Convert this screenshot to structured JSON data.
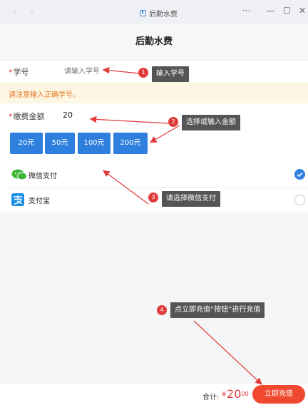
{
  "window": {
    "back_glyph": "‹",
    "forward_glyph": "›",
    "title": "后勤水费",
    "more_glyph": "···",
    "min_glyph": "—",
    "max_glyph": "☐",
    "close_glyph": "✕"
  },
  "page": {
    "title": "后勤水费"
  },
  "student_id": {
    "required_mark": "*",
    "label": "学号",
    "placeholder": "请输入学号",
    "value": ""
  },
  "warning": "请注意输入正确学号。",
  "amount": {
    "required_mark": "*",
    "label": "缴费金额",
    "value": "20"
  },
  "amount_options": [
    "20元",
    "50元",
    "100元",
    "200元"
  ],
  "payment_methods": [
    {
      "label": "微信支付",
      "icon": "wechat-icon",
      "selected": true
    },
    {
      "label": "支付宝",
      "icon": "alipay-icon",
      "selected": false
    }
  ],
  "annotations": [
    {
      "number": "1",
      "text": "输入学号"
    },
    {
      "number": "2",
      "text": "选择或输入金额"
    },
    {
      "number": "3",
      "text": "请选择微信支付"
    },
    {
      "number": "4",
      "text": "点立即充值“按钮”进行充值"
    }
  ],
  "footer": {
    "total_label": "合计:",
    "currency": "¥",
    "amount_int": "20",
    "amount_dec": ".00",
    "button": "立即充值"
  },
  "colors": {
    "accent": "#2e7fde",
    "cta": "#f0492f",
    "warning_bg": "#fcf6e2",
    "warning_text": "#e87a2a",
    "annotation_red": "#e23b3b"
  }
}
